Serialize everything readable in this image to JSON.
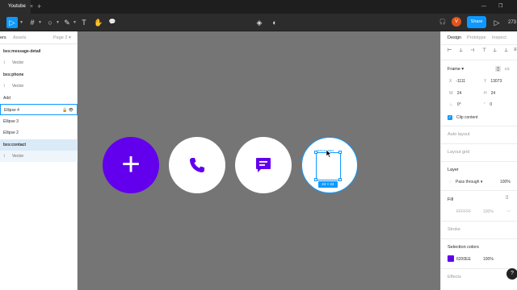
{
  "app": {
    "tab_title": "Youtube",
    "tab_close": "×",
    "tab_add": "+",
    "win_min": "—",
    "win_restore": "❐"
  },
  "toolbar": {
    "move_tool": "▷",
    "frame_tool": "#",
    "shape_tool": "○",
    "pen_tool": "✎",
    "text_tool": "T",
    "hand_tool": "✋",
    "comment_tool": "💬",
    "component_icon": "◈",
    "mode_icon": "◐",
    "headphones_icon": "🎧",
    "avatar_initial": "V",
    "share_label": "Share",
    "present_icon": "▷",
    "zoom_label": "273"
  },
  "left_panel": {
    "layers_tab": "ers",
    "assets_tab": "Assets",
    "page_label": "Page 2",
    "layers": [
      {
        "label": "bxs:message-detail",
        "kind": "frame"
      },
      {
        "label": "Vector",
        "kind": "child"
      },
      {
        "label": "bxs:phone",
        "kind": "frame"
      },
      {
        "label": "Vector",
        "kind": "child"
      },
      {
        "label": "Add",
        "kind": "plain"
      },
      {
        "label": "Ellipse 4",
        "kind": "hover"
      },
      {
        "label": "Ellipse 3",
        "kind": "plain"
      },
      {
        "label": "Ellipse 2",
        "kind": "plain"
      },
      {
        "label": "bxs:contact",
        "kind": "selected"
      },
      {
        "label": "Vector",
        "kind": "subselected"
      }
    ]
  },
  "canvas": {
    "frame_label": "bxs:contact",
    "size_label": "24 × 24",
    "plus_glyph": "+"
  },
  "right_panel": {
    "tabs": [
      "Design",
      "Prototype",
      "Inspect"
    ],
    "frame_section": "Frame",
    "x_label": "X",
    "x_value": "-1111",
    "y_label": "Y",
    "y_value": "13073",
    "w_label": "W",
    "w_value": "24",
    "h_label": "H",
    "h_value": "24",
    "rotation_value": "0°",
    "radius_value": "0",
    "clip_content": "Clip content",
    "auto_layout": "Auto layout",
    "layout_grid": "Layout grid",
    "layer_section": "Layer",
    "blend_mode": "Pass through",
    "layer_opacity": "100%",
    "fill_section": "Fill",
    "fill_hex": "FFFFFF",
    "fill_opacity": "100%",
    "stroke_section": "Stroke",
    "selection_colors": "Selection colors",
    "sel_color_hex": "6200EE",
    "sel_color_opacity": "100%",
    "effects_section": "Effects",
    "help_glyph": "?"
  },
  "colors": {
    "accent": "#0d99ff",
    "brand_purple": "#6200ee",
    "canvas_bg": "#757575"
  }
}
